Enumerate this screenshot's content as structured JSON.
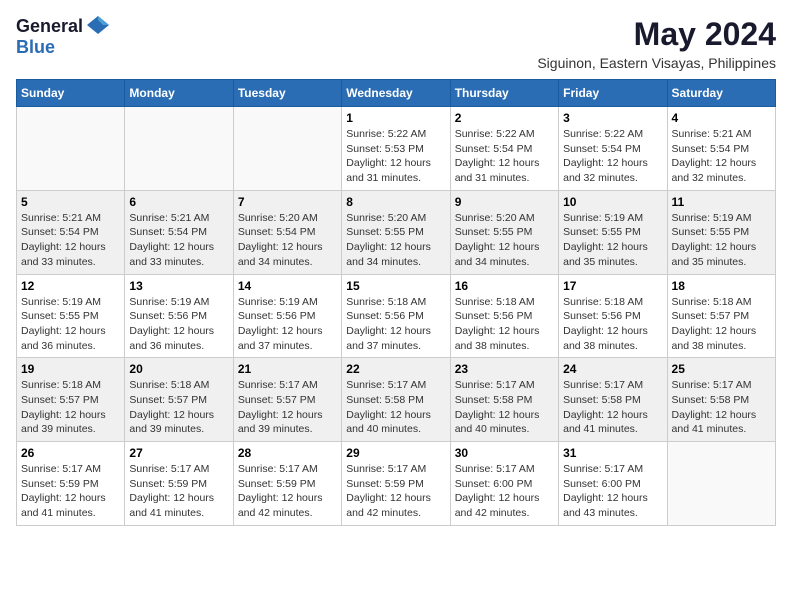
{
  "logo": {
    "general": "General",
    "blue": "Blue"
  },
  "title": "May 2024",
  "location": "Siguinon, Eastern Visayas, Philippines",
  "days_of_week": [
    "Sunday",
    "Monday",
    "Tuesday",
    "Wednesday",
    "Thursday",
    "Friday",
    "Saturday"
  ],
  "weeks": [
    [
      {
        "day": "",
        "info": ""
      },
      {
        "day": "",
        "info": ""
      },
      {
        "day": "",
        "info": ""
      },
      {
        "day": "1",
        "info": "Sunrise: 5:22 AM\nSunset: 5:53 PM\nDaylight: 12 hours\nand 31 minutes."
      },
      {
        "day": "2",
        "info": "Sunrise: 5:22 AM\nSunset: 5:54 PM\nDaylight: 12 hours\nand 31 minutes."
      },
      {
        "day": "3",
        "info": "Sunrise: 5:22 AM\nSunset: 5:54 PM\nDaylight: 12 hours\nand 32 minutes."
      },
      {
        "day": "4",
        "info": "Sunrise: 5:21 AM\nSunset: 5:54 PM\nDaylight: 12 hours\nand 32 minutes."
      }
    ],
    [
      {
        "day": "5",
        "info": "Sunrise: 5:21 AM\nSunset: 5:54 PM\nDaylight: 12 hours\nand 33 minutes."
      },
      {
        "day": "6",
        "info": "Sunrise: 5:21 AM\nSunset: 5:54 PM\nDaylight: 12 hours\nand 33 minutes."
      },
      {
        "day": "7",
        "info": "Sunrise: 5:20 AM\nSunset: 5:54 PM\nDaylight: 12 hours\nand 34 minutes."
      },
      {
        "day": "8",
        "info": "Sunrise: 5:20 AM\nSunset: 5:55 PM\nDaylight: 12 hours\nand 34 minutes."
      },
      {
        "day": "9",
        "info": "Sunrise: 5:20 AM\nSunset: 5:55 PM\nDaylight: 12 hours\nand 34 minutes."
      },
      {
        "day": "10",
        "info": "Sunrise: 5:19 AM\nSunset: 5:55 PM\nDaylight: 12 hours\nand 35 minutes."
      },
      {
        "day": "11",
        "info": "Sunrise: 5:19 AM\nSunset: 5:55 PM\nDaylight: 12 hours\nand 35 minutes."
      }
    ],
    [
      {
        "day": "12",
        "info": "Sunrise: 5:19 AM\nSunset: 5:55 PM\nDaylight: 12 hours\nand 36 minutes."
      },
      {
        "day": "13",
        "info": "Sunrise: 5:19 AM\nSunset: 5:56 PM\nDaylight: 12 hours\nand 36 minutes."
      },
      {
        "day": "14",
        "info": "Sunrise: 5:19 AM\nSunset: 5:56 PM\nDaylight: 12 hours\nand 37 minutes."
      },
      {
        "day": "15",
        "info": "Sunrise: 5:18 AM\nSunset: 5:56 PM\nDaylight: 12 hours\nand 37 minutes."
      },
      {
        "day": "16",
        "info": "Sunrise: 5:18 AM\nSunset: 5:56 PM\nDaylight: 12 hours\nand 38 minutes."
      },
      {
        "day": "17",
        "info": "Sunrise: 5:18 AM\nSunset: 5:56 PM\nDaylight: 12 hours\nand 38 minutes."
      },
      {
        "day": "18",
        "info": "Sunrise: 5:18 AM\nSunset: 5:57 PM\nDaylight: 12 hours\nand 38 minutes."
      }
    ],
    [
      {
        "day": "19",
        "info": "Sunrise: 5:18 AM\nSunset: 5:57 PM\nDaylight: 12 hours\nand 39 minutes."
      },
      {
        "day": "20",
        "info": "Sunrise: 5:18 AM\nSunset: 5:57 PM\nDaylight: 12 hours\nand 39 minutes."
      },
      {
        "day": "21",
        "info": "Sunrise: 5:17 AM\nSunset: 5:57 PM\nDaylight: 12 hours\nand 39 minutes."
      },
      {
        "day": "22",
        "info": "Sunrise: 5:17 AM\nSunset: 5:58 PM\nDaylight: 12 hours\nand 40 minutes."
      },
      {
        "day": "23",
        "info": "Sunrise: 5:17 AM\nSunset: 5:58 PM\nDaylight: 12 hours\nand 40 minutes."
      },
      {
        "day": "24",
        "info": "Sunrise: 5:17 AM\nSunset: 5:58 PM\nDaylight: 12 hours\nand 41 minutes."
      },
      {
        "day": "25",
        "info": "Sunrise: 5:17 AM\nSunset: 5:58 PM\nDaylight: 12 hours\nand 41 minutes."
      }
    ],
    [
      {
        "day": "26",
        "info": "Sunrise: 5:17 AM\nSunset: 5:59 PM\nDaylight: 12 hours\nand 41 minutes."
      },
      {
        "day": "27",
        "info": "Sunrise: 5:17 AM\nSunset: 5:59 PM\nDaylight: 12 hours\nand 41 minutes."
      },
      {
        "day": "28",
        "info": "Sunrise: 5:17 AM\nSunset: 5:59 PM\nDaylight: 12 hours\nand 42 minutes."
      },
      {
        "day": "29",
        "info": "Sunrise: 5:17 AM\nSunset: 5:59 PM\nDaylight: 12 hours\nand 42 minutes."
      },
      {
        "day": "30",
        "info": "Sunrise: 5:17 AM\nSunset: 6:00 PM\nDaylight: 12 hours\nand 42 minutes."
      },
      {
        "day": "31",
        "info": "Sunrise: 5:17 AM\nSunset: 6:00 PM\nDaylight: 12 hours\nand 43 minutes."
      },
      {
        "day": "",
        "info": ""
      }
    ]
  ]
}
